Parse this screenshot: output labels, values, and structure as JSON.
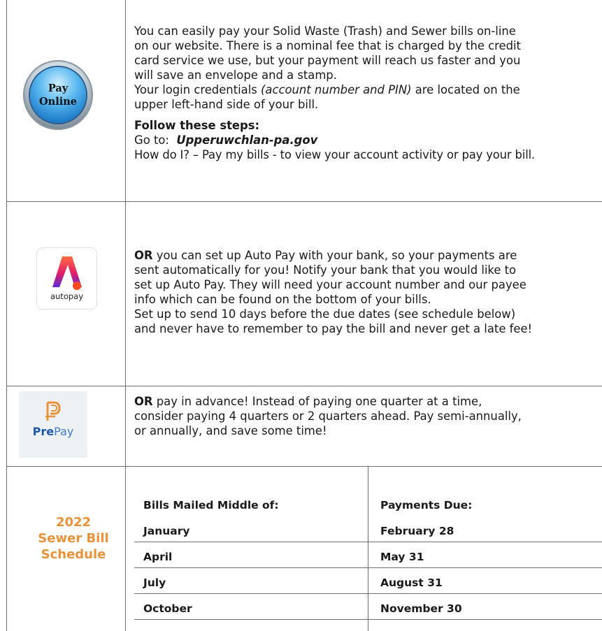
{
  "pay_online": {
    "icon_label_line1": "Pay",
    "icon_label_line2": "Online",
    "paragraph": [
      "You can easily pay your Solid Waste (Trash) and Sewer bills on-line",
      "on our website. There is a nominal fee that is charged by the credit",
      "card service we use, but your payment will reach us faster and you",
      "will save an envelope and a stamp."
    ],
    "credentials_before": "Your login credentials ",
    "credentials_italic": "(account number and PIN)",
    "credentials_after": " are located on the",
    "credentials_line2": "upper left-hand side of your bill.",
    "steps_heading": "Follow these steps:",
    "go_to_label": "Go to:",
    "website": "Upperuwchlan-pa.gov",
    "how_do_i": "How do I? – Pay my bills - to view your account activity or pay your bill."
  },
  "autopay": {
    "icon_label": "autopay",
    "bold_start": "OR",
    "line1_rest": " you can set up Auto Pay with your bank, so your payments are",
    "line2": "sent automatically for you! Notify your bank that you would like to",
    "line3": "set up Auto Pay. They will need your account number and our payee",
    "line4": "info which can be found on the bottom of your bills.",
    "line5": "Set up to send 10 days before the due dates (see schedule below)",
    "line6": "and never have to remember to pay the bill and never get a late fee!"
  },
  "prepay": {
    "icon_label_pre": "Pre",
    "icon_label_pay": "Pay",
    "bold_start": "OR",
    "line1_rest": " pay in advance!  Instead of paying one quarter at a time,",
    "line2": "consider paying 4 quarters or 2 quarters ahead. Pay semi-annually,",
    "line3": "or annually, and save some time!"
  },
  "schedule": {
    "title_line1": "2022",
    "title_line2": "Sewer Bill",
    "title_line3": "Schedule",
    "header_mailed": "Bills Mailed Middle of:",
    "header_due": "Payments Due:",
    "rows": [
      {
        "mailed": "January",
        "due": "February 28"
      },
      {
        "mailed": "April",
        "due": "May 31"
      },
      {
        "mailed": "July",
        "due": "August 31"
      },
      {
        "mailed": "October",
        "due": "November 30"
      }
    ]
  },
  "colors": {
    "accent_orange": "#e8923a",
    "prepay_blue": "#1b59a8",
    "grid_gray": "#6b6b6b"
  }
}
